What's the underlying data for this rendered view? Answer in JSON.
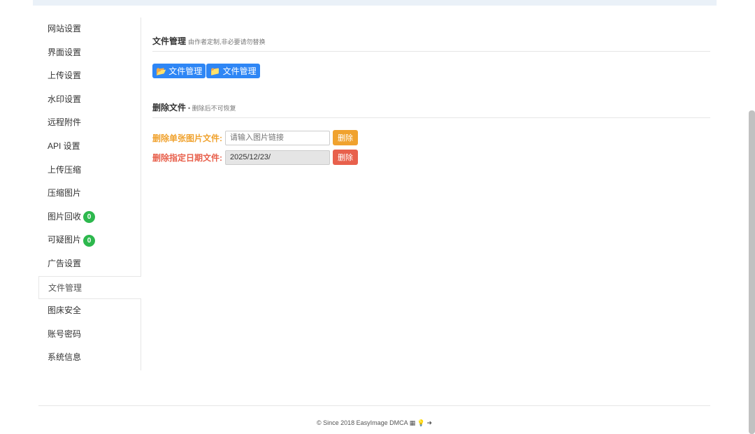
{
  "sidebar": {
    "items": [
      {
        "label": "网站设置"
      },
      {
        "label": "界面设置"
      },
      {
        "label": "上传设置"
      },
      {
        "label": "水印设置"
      },
      {
        "label": "远程附件"
      },
      {
        "label": "API 设置"
      },
      {
        "label": "上传压缩"
      },
      {
        "label": "压缩图片"
      },
      {
        "label": "图片回收",
        "badge": "0"
      },
      {
        "label": "可疑图片",
        "badge": "0"
      },
      {
        "label": "广告设置"
      },
      {
        "label": "文件管理"
      },
      {
        "label": "图床安全"
      },
      {
        "label": "账号密码"
      },
      {
        "label": "系统信息"
      }
    ]
  },
  "file_manage": {
    "title": "文件管理",
    "subtitle": "由作者定制,非必要请勿替换",
    "btn1": "文件管理",
    "btn2": "文件管理"
  },
  "delete": {
    "title": "删除文件",
    "subtitle": "• 删除后不可恢复",
    "single_label": "删除单张图片文件:",
    "single_placeholder": "请输入图片链接",
    "single_btn": "删除",
    "date_label": "删除指定日期文件:",
    "date_value": "2025/12/23/",
    "date_btn": "删除",
    "colors": {
      "single": "#f0a22e",
      "date": "#e8604c"
    }
  },
  "footer": {
    "text": "© Since 2018 EasyImage DMCA"
  }
}
